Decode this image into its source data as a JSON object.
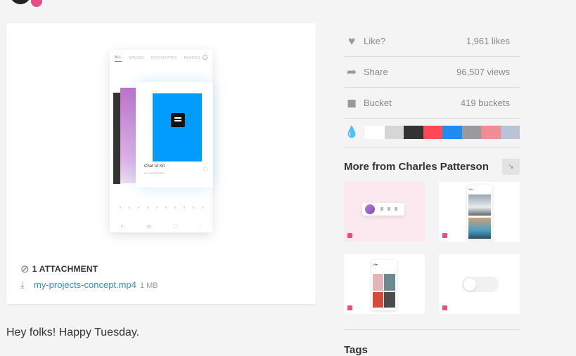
{
  "shot": {
    "preview": {
      "tabs": [
        "ALL",
        "SPACES",
        "PROTOTYPES",
        "BOARDS"
      ],
      "card_title": "Chat UI Kit",
      "card_subtitle": "60 SCREENS",
      "nav_icons": [
        "in",
        "folder-icon",
        "bookmark-icon",
        "user-icon"
      ]
    },
    "attachment": {
      "heading": "1 ATTACHMENT",
      "file_name": "my-projects-concept.mp4",
      "file_size": "1 MB"
    },
    "description": "Hey folks! Happy Tuesday."
  },
  "stats": {
    "like_label": "Like?",
    "likes": "1,961 likes",
    "share_label": "Share",
    "views": "96,507 views",
    "bucket_label": "Bucket",
    "buckets": "419 buckets"
  },
  "palette": [
    "#ffffff",
    "#d6d6d9",
    "#333333",
    "#ff4a55",
    "#1e8cf0",
    "#9a9a9e",
    "#f08c96",
    "#b9c2d6"
  ],
  "more": {
    "title": "More from Charles Patterson",
    "thumb2_label": "You",
    "thumb3_label": "Life"
  },
  "tags_title": "Tags",
  "colors": {
    "accent": "#ea4c89",
    "link": "#2f8fc5"
  }
}
